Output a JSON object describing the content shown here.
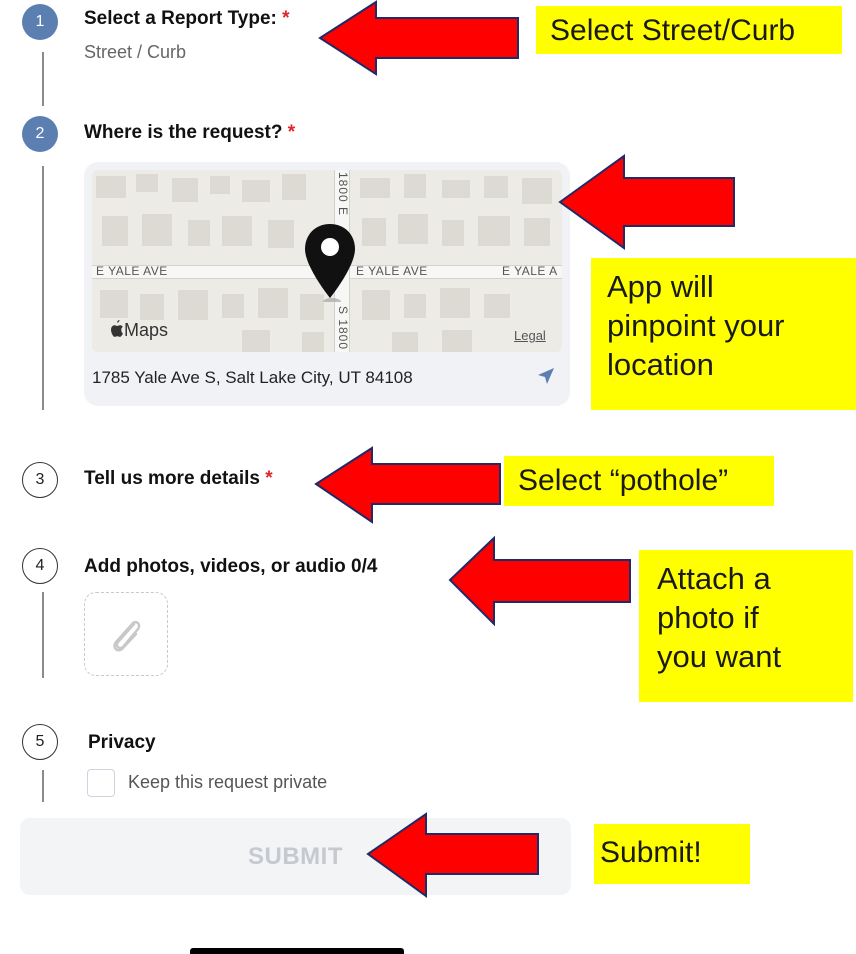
{
  "steps": [
    {
      "number": "1",
      "title": "Select a Report Type:",
      "required": "*",
      "value": "Street / Curb"
    },
    {
      "number": "2",
      "title": "Where is the request?",
      "required": "*"
    },
    {
      "number": "3",
      "title": "Tell us more details",
      "required": "*"
    },
    {
      "number": "4",
      "title": "Add photos, videos, or audio 0/4"
    },
    {
      "number": "5",
      "title": "Privacy"
    }
  ],
  "map": {
    "street_labels": [
      "E YALE AVE",
      "E YALE AVE",
      "E YALE A"
    ],
    "cross_street_top": "1800 E",
    "cross_street_bottom": "S 1800",
    "logo_text": "Maps",
    "legal": "Legal",
    "address": "1785 Yale Ave S, Salt Lake City, UT 84108"
  },
  "privacy": {
    "checkbox_label": "Keep this request private",
    "checked": false
  },
  "submit_label": "SUBMIT",
  "callouts": {
    "step1": "Select Street/Curb",
    "step2": [
      "App will",
      "pinpoint your",
      "location"
    ],
    "step3": "Select “pothole”",
    "step4": [
      "Attach a",
      "photo if",
      "you want"
    ],
    "submit": "Submit!"
  },
  "icons": [
    "map-pin-icon",
    "apple-logo-icon",
    "location-arrow-icon",
    "paperclip-icon"
  ],
  "colors": {
    "accent": "#5b7fb1",
    "required": "#e0252b",
    "callout": "#ffff00",
    "arrow": "#ff0000"
  }
}
